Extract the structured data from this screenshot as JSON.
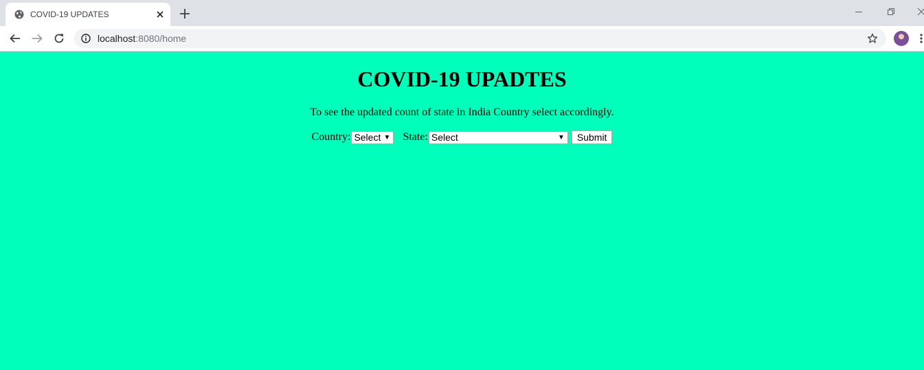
{
  "browser": {
    "tab_title": "COVID-19 UPDATES",
    "url_host": "localhost",
    "url_path": ":8080/home",
    "icons": {
      "favicon": "globe-icon",
      "tab_close": "close-icon",
      "new_tab": "plus-icon",
      "back": "arrow-left-icon",
      "forward": "arrow-right-icon",
      "reload": "reload-icon",
      "site_info": "info-icon",
      "bookmark": "star-icon",
      "menu": "kebab-menu-icon"
    }
  },
  "page": {
    "background_color": "#00ffbb",
    "title": "COVID-19 UPADTES",
    "description": "To see the updated count of state in India Country select accordingly.",
    "form": {
      "country_label": "Country:",
      "country_selected": "Select",
      "state_label": "State:",
      "state_selected": "Select",
      "submit_label": "Submit"
    }
  }
}
